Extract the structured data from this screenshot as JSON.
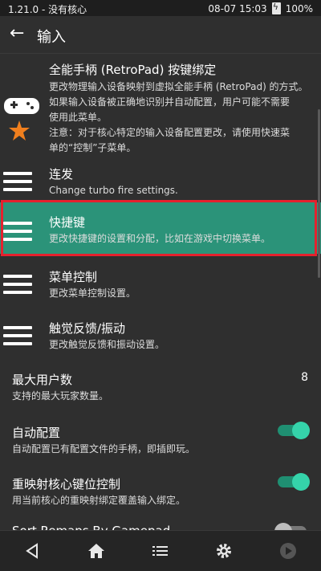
{
  "status": {
    "left": "1.21.0 - 没有核心",
    "time": "08-07 15:03",
    "battery": "100%"
  },
  "appbar": {
    "title": "输入"
  },
  "items": [
    {
      "title": "全能手柄 (RetroPad) 按键绑定",
      "desc1": "更改物理输入设备映射到虚拟全能手柄 (RetroPad) 的方式。",
      "desc2": "如果输入设备被正确地识别并自动配置，用户可能不需要",
      "desc3": "使用此菜单。",
      "desc4": "注意：对于核心特定的输入设备配置更改，请使用快速菜",
      "desc5": "单的“控制”子菜单。"
    },
    {
      "title": "连发",
      "desc": "Change turbo fire settings."
    },
    {
      "title": "快捷键",
      "desc": "更改快捷键的设置和分配，比如在游戏中切换菜单。"
    },
    {
      "title": "菜单控制",
      "desc": "更改菜单控制设置。"
    },
    {
      "title": "触觉反馈/振动",
      "desc": "更改触觉反馈和振动设置。"
    },
    {
      "title": "最大用户数",
      "desc": "支持的最大玩家数量。",
      "value": "8"
    },
    {
      "title": "自动配置",
      "desc": "自动配置已有配置文件的手柄，即插即玩。",
      "toggle": "on"
    },
    {
      "title": "重映射核心键位控制",
      "desc": "用当前核心的重映射绑定覆盖输入绑定。",
      "toggle": "on"
    },
    {
      "title": "Sort Remaps By Gamepad",
      "toggle": "off"
    }
  ],
  "colors": {
    "selected": "#2b9379",
    "highlight_border": "#e5212e",
    "toggle_on": "#35d3aa"
  },
  "navbar": [
    "back-icon",
    "home-icon",
    "list-icon",
    "gear-icon",
    "play-icon"
  ]
}
